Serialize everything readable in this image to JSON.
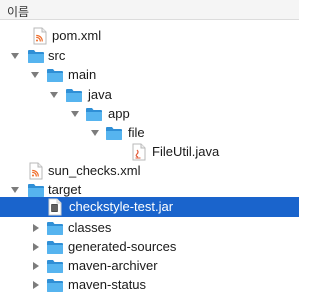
{
  "header": {
    "name_column_label": "이름"
  },
  "tree": {
    "items": [
      {
        "name": "pom.xml",
        "kind": "xml",
        "icon": "xml-file-icon"
      },
      {
        "name": "src",
        "kind": "folder",
        "icon": "folder-icon",
        "state": "expanded"
      },
      {
        "name": "main",
        "kind": "folder",
        "icon": "folder-icon",
        "state": "expanded"
      },
      {
        "name": "java",
        "kind": "folder",
        "icon": "folder-icon",
        "state": "expanded"
      },
      {
        "name": "app",
        "kind": "folder",
        "icon": "folder-icon",
        "state": "expanded"
      },
      {
        "name": "file",
        "kind": "folder",
        "icon": "folder-icon",
        "state": "expanded"
      },
      {
        "name": "FileUtil.java",
        "kind": "java",
        "icon": "java-file-icon"
      },
      {
        "name": "sun_checks.xml",
        "kind": "xml",
        "icon": "xml-file-icon"
      },
      {
        "name": "target",
        "kind": "folder",
        "icon": "folder-icon",
        "state": "expanded"
      },
      {
        "name": "checkstyle-test.jar",
        "kind": "jar",
        "icon": "jar-file-icon",
        "selected": true
      },
      {
        "name": "classes",
        "kind": "folder",
        "icon": "folder-icon",
        "state": "collapsed"
      },
      {
        "name": "generated-sources",
        "kind": "folder",
        "icon": "folder-icon",
        "state": "collapsed"
      },
      {
        "name": "maven-archiver",
        "kind": "folder",
        "icon": "folder-icon",
        "state": "collapsed"
      },
      {
        "name": "maven-status",
        "kind": "folder",
        "icon": "folder-icon",
        "state": "collapsed"
      }
    ]
  },
  "colors": {
    "selection": "#1a64cc",
    "folder": "#47a7e6",
    "xml_badge": "#ef6c2a",
    "java_badge": "#e25b3a"
  }
}
